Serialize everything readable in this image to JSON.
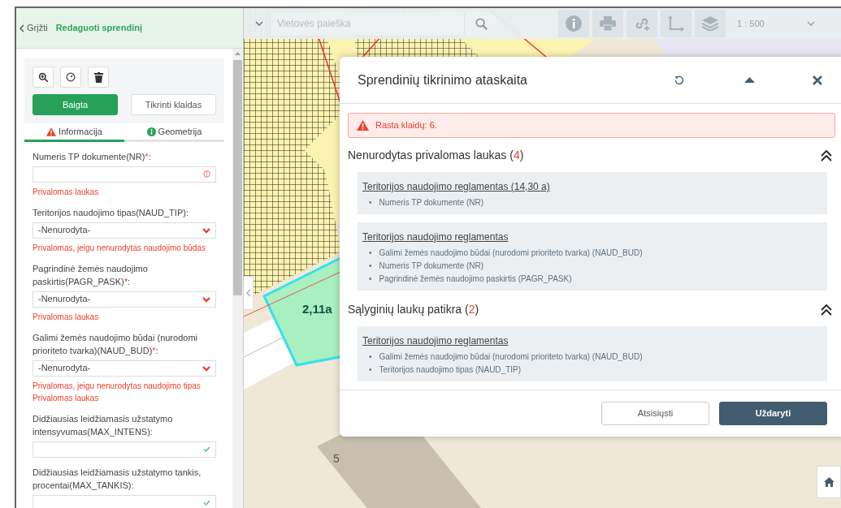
{
  "sidebar": {
    "back": "Grįžti",
    "title": "Redaguoti sprendinį",
    "actions": [
      {
        "label": "Baigta",
        "kind": "primary"
      },
      {
        "label": "Tikrinti klaidas",
        "kind": "secondary"
      }
    ],
    "tabs": [
      {
        "label": "Informacija",
        "selected": true,
        "kind": "warning"
      },
      {
        "label": "Geometrija",
        "selected": false,
        "kind": "info"
      }
    ],
    "fields": [
      {
        "label": "Numeris TP dokumente(NR)",
        "mark": "*",
        "label_end": ":",
        "kind": "text",
        "valid": false,
        "errors": [
          "Privalomas laukas"
        ]
      },
      {
        "label": "Teritorijos naudojimo tipas(NAUD_TIP):",
        "kind": "select",
        "value": "-Nenurodyta-",
        "valid": false,
        "errors": [
          "Privalomas, jeigu nenurodytas naudojimo būdas"
        ]
      },
      {
        "label": "Pagrindinė žemės naudojimo paskirtis(PAGR_PASK)",
        "mark": "*",
        "label_end": ":",
        "kind": "select",
        "value": "-Nenurodyta-",
        "valid": false,
        "errors": [
          "Privalomas laukas"
        ]
      },
      {
        "label": "Galimi žemės naudojimo būdai (nurodomi prioriteto tvarka)(NAUD_BUD)",
        "mark": "*",
        "label_end": ":",
        "kind": "select",
        "value": "-Nenurodyta-",
        "valid": false,
        "errors": [
          "Privalomas, jeigu nenurodytas naudojimo tipas",
          "Privalomas laukas"
        ]
      },
      {
        "label": "Didžiausias leidžiamasis užstatymo intensyvumas(MAX_INTENS):",
        "kind": "text",
        "valid": true
      },
      {
        "label": "Didžiausias leidžiamasis užstatymo tankis, procentai(MAX_TANKIS):",
        "kind": "text",
        "valid": true
      }
    ]
  },
  "map": {
    "search_placeholder": "Vietovės paieška",
    "scale": "1 : 500",
    "labels": [
      {
        "text": "2,11a",
        "kind": "area"
      },
      {
        "text": "5",
        "kind": "house"
      }
    ]
  },
  "report": {
    "title": "Sprendinių tikrinimo ataskaita",
    "alert": "Rasta klaidų: 6.",
    "sections": [
      {
        "title": "Nenurodytas privalomas laukas (",
        "count": "4",
        "title_end": ")",
        "expanded": true,
        "groups": [
          {
            "title": "Teritorijos naudojimo reglamentas (14,30 a)",
            "items": [
              {
                "marker": "•",
                "text": "Numeris TP dokumente (NR)"
              }
            ]
          },
          {
            "title": "Teritorijos naudojimo reglamentas",
            "items": [
              {
                "marker": "•",
                "text": "Galimi žemės naudojimo būdai (nurodomi prioriteto tvarka) (NAUD_BUD)"
              },
              {
                "marker": "•",
                "text": "Numeris TP dokumente (NR)"
              },
              {
                "marker": "•",
                "text": "Pagrindinė žemės naudojimo paskirtis (PAGR_PASK)"
              }
            ]
          }
        ]
      },
      {
        "title": "Sąlyginių laukų patikra (",
        "count": "2",
        "title_end": ")",
        "expanded": true,
        "groups": [
          {
            "title": "Teritorijos naudojimo reglamentas",
            "items": [
              {
                "marker": "•",
                "text": "Galimi žemės naudojimo būdai (nurodomi prioriteto tvarka) (NAUD_BUD)"
              },
              {
                "marker": "•",
                "text": "Teritorijos naudojimo tipas (NAUD_TIP)"
              }
            ]
          }
        ]
      }
    ],
    "buttons": [
      {
        "label": "Atsisiųsti",
        "kind": "secondary"
      },
      {
        "label": "Uždaryti",
        "kind": "primary"
      }
    ]
  }
}
